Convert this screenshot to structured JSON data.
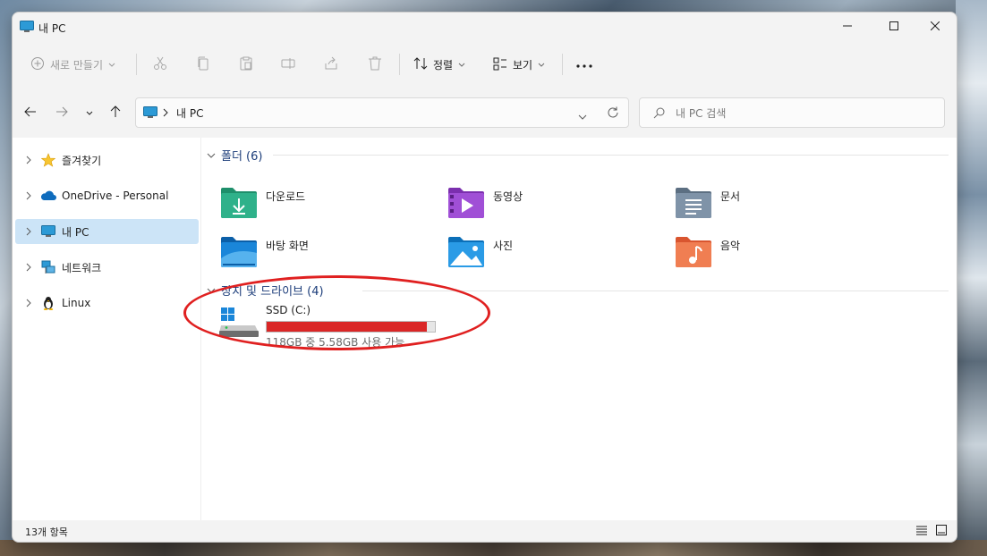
{
  "window": {
    "title": "내 PC"
  },
  "toolbar": {
    "new_label": "새로 만들기",
    "sort_label": "정렬",
    "view_label": "보기",
    "icons": [
      "cut-icon",
      "copy-icon",
      "paste-icon",
      "rename-icon",
      "share-icon",
      "delete-icon"
    ]
  },
  "address": {
    "path": "내 PC"
  },
  "search": {
    "placeholder": "내 PC 검색"
  },
  "sidebar": {
    "items": [
      {
        "label": "즐겨찾기",
        "icon": "star-icon"
      },
      {
        "label": "OneDrive - Personal",
        "icon": "cloud-icon"
      },
      {
        "label": "내 PC",
        "icon": "monitor-icon",
        "selected": true
      },
      {
        "label": "네트워크",
        "icon": "network-icon"
      },
      {
        "label": "Linux",
        "icon": "penguin-icon"
      }
    ]
  },
  "folders": {
    "header": "폴더 (6)",
    "items": [
      {
        "label": "다운로드",
        "icon": "downloads-folder-icon"
      },
      {
        "label": "동영상",
        "icon": "videos-folder-icon"
      },
      {
        "label": "문서",
        "icon": "documents-folder-icon"
      },
      {
        "label": "바탕 화면",
        "icon": "desktop-folder-icon"
      },
      {
        "label": "사진",
        "icon": "pictures-folder-icon"
      },
      {
        "label": "음악",
        "icon": "music-folder-icon"
      }
    ]
  },
  "devices": {
    "header": "장치 및 드라이브 (4)",
    "drive": {
      "name": "SSD (C:)",
      "usage_text": "118GB 중 5.58GB 사용 가능",
      "used_fraction": 0.953
    }
  },
  "status": {
    "count": "13개 항목"
  },
  "colors": {
    "accent": "#0067c0",
    "selection": "#cce4f7",
    "drive_bar": "#da2626",
    "annotation": "#e02020"
  }
}
